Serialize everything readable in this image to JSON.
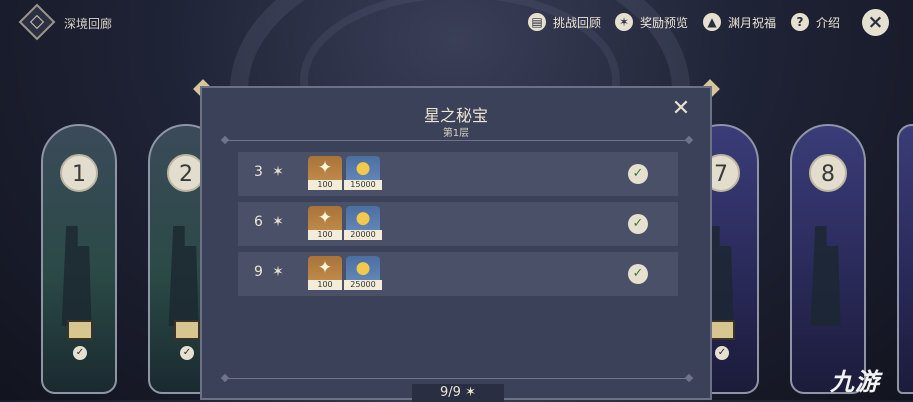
{
  "header": {
    "title": "深境回廊",
    "buttons": [
      {
        "label": "挑战回顾",
        "icon": "book-icon"
      },
      {
        "label": "奖励预览",
        "icon": "star-gear-icon"
      },
      {
        "label": "渊月祝福",
        "icon": "up-arrow-icon"
      },
      {
        "label": "介绍",
        "icon": "help-icon"
      }
    ],
    "close_icon": "×"
  },
  "floors": [
    {
      "number": "1"
    },
    {
      "number": "2"
    },
    {
      "number": "7"
    },
    {
      "number": "8"
    }
  ],
  "modal": {
    "title": "星之秘宝",
    "subtitle": "第1层",
    "rows": [
      {
        "stars": "3",
        "primo_qty": "100",
        "mora_qty": "15000"
      },
      {
        "stars": "6",
        "primo_qty": "100",
        "mora_qty": "20000"
      },
      {
        "stars": "9",
        "primo_qty": "100",
        "mora_qty": "25000"
      }
    ],
    "progress": "9/9"
  },
  "watermark": "九游",
  "colors": {
    "accent": "#d6c69a",
    "panel": "#3b4158",
    "row": "#4a5068"
  }
}
